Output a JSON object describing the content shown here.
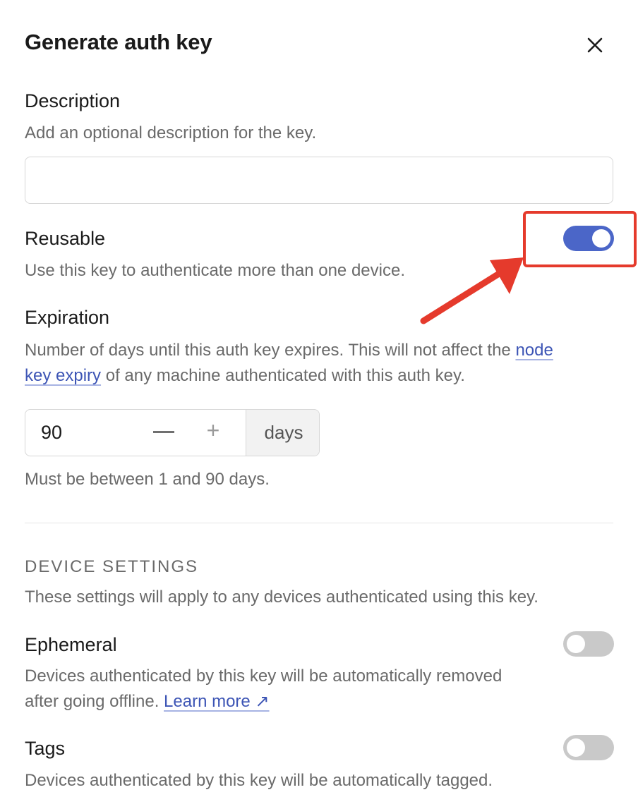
{
  "dialog": {
    "title": "Generate auth key"
  },
  "description": {
    "heading": "Description",
    "help": "Add an optional description for the key.",
    "value": "",
    "placeholder": ""
  },
  "reusable": {
    "heading": "Reusable",
    "help": "Use this key to authenticate more than one device.",
    "enabled": true
  },
  "expiration": {
    "heading": "Expiration",
    "help_line1_prefix": "Number of days until this auth key expires. This will not affect the ",
    "help_link_part1": "node",
    "help_link_part2": "key expiry",
    "help_line2_suffix": " of any machine authenticated with this auth key.",
    "value": "90",
    "unit": "days",
    "note": "Must be between 1 and 90 days."
  },
  "device_settings": {
    "section_title": "DEVICE SETTINGS",
    "help": "These settings will apply to any devices authenticated using this key."
  },
  "ephemeral": {
    "heading": "Ephemeral",
    "help_line1": "Devices authenticated by this key will be automatically removed",
    "help_line2_prefix": "after going offline. ",
    "learn_more": "Learn more ↗",
    "enabled": false
  },
  "tags": {
    "heading": "Tags",
    "help": "Devices authenticated by this key will be automatically tagged.",
    "enabled": false
  },
  "colors": {
    "accent": "#4b66c8",
    "annotation": "#e53a2c"
  }
}
